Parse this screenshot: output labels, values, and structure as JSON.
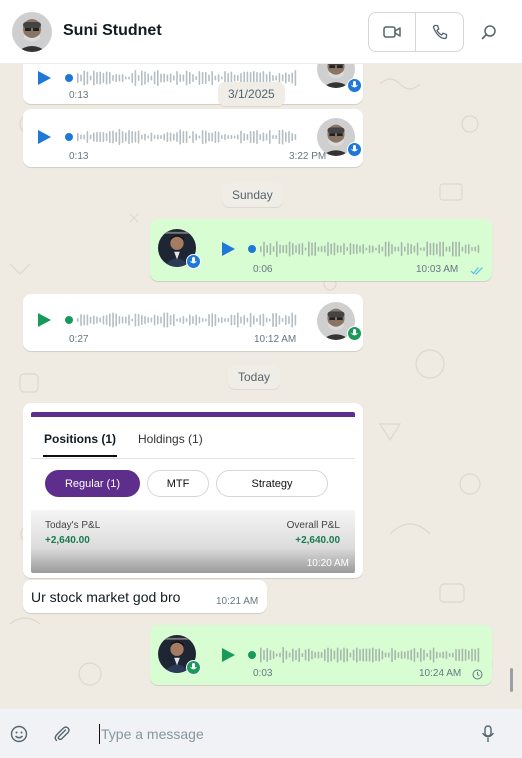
{
  "header": {
    "contact_name": "Suni Studnet",
    "icons": {
      "video": "video-camera-icon",
      "call": "phone-icon",
      "search": "search-icon"
    }
  },
  "messages": [
    {
      "type": "voice",
      "direction": "in",
      "duration": "0:13",
      "time": "",
      "progress": 0
    },
    {
      "type": "voice",
      "direction": "in",
      "duration": "0:13",
      "time": "3:22 PM",
      "progress": 0
    },
    {
      "type": "voice",
      "direction": "out",
      "duration": "0:06",
      "time": "10:03 AM",
      "status": "read",
      "progress": 0
    },
    {
      "type": "voice",
      "direction": "in",
      "duration": "0:27",
      "time": "10:12 AM",
      "progress": 0,
      "played": true
    },
    {
      "type": "image",
      "direction": "in",
      "time": "10:20 AM",
      "image": {
        "tabs": [
          "Positions (1)",
          "Holdings (1)"
        ],
        "chips": [
          "Regular (1)",
          "MTF",
          "Strategy"
        ],
        "pnl_left_label": "Today's P&L",
        "pnl_left_value": "+2,640.00",
        "pnl_right_label": "Overall P&L",
        "pnl_right_value": "+2,640.00"
      }
    },
    {
      "type": "text",
      "direction": "in",
      "text": "Ur stock market god bro",
      "time": "10:21 AM"
    },
    {
      "type": "voice",
      "direction": "out",
      "duration": "0:03",
      "time": "10:24 AM",
      "status": "pending",
      "progress": 0,
      "played": true
    }
  ],
  "date_pills": [
    "3/1/2025",
    "Sunday",
    "Today"
  ],
  "composer": {
    "placeholder": "Type a message",
    "icons": {
      "emoji": "emoji-icon",
      "attach": "paperclip-icon",
      "mic": "microphone-icon"
    }
  },
  "colors": {
    "incoming_bubble": "#ffffff",
    "outgoing_bubble": "#d9fdd3",
    "chat_background": "#efeae2",
    "play_blue": "#1d78d8",
    "play_green": "#1a9a5a",
    "read_ticks": "#53bdeb",
    "brand_purple": "#5d2e8c"
  }
}
